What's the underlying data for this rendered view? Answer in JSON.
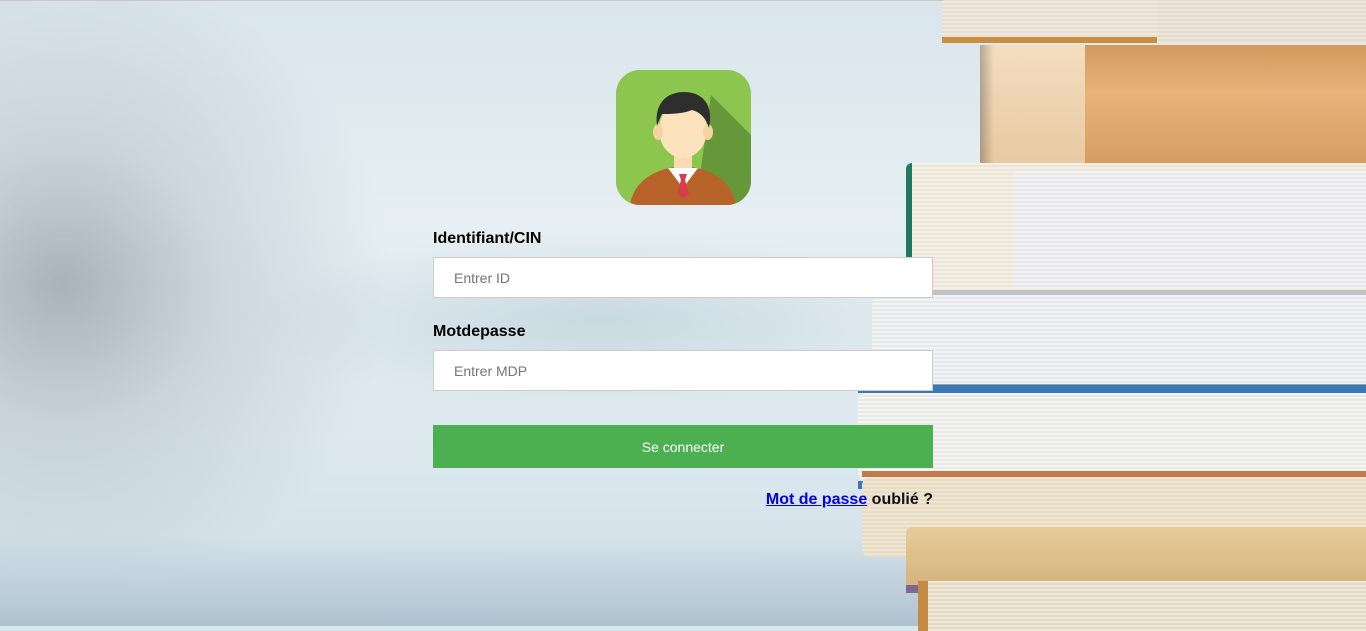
{
  "login_form": {
    "id_label": "Identifiant/CIN",
    "id_placeholder": "Entrer ID",
    "id_value": "",
    "password_label": "Motdepasse",
    "password_placeholder": "Entrer MDP",
    "password_value": "",
    "submit_label": "Se connecter",
    "forgot_link_text": "Mot de passe",
    "forgot_suffix": " oublié ?"
  },
  "icons": {
    "avatar": "user-avatar-icon"
  },
  "colors": {
    "button": "#4cb050",
    "avatar_bg": "#8cc64f",
    "link": "#0000ee"
  }
}
